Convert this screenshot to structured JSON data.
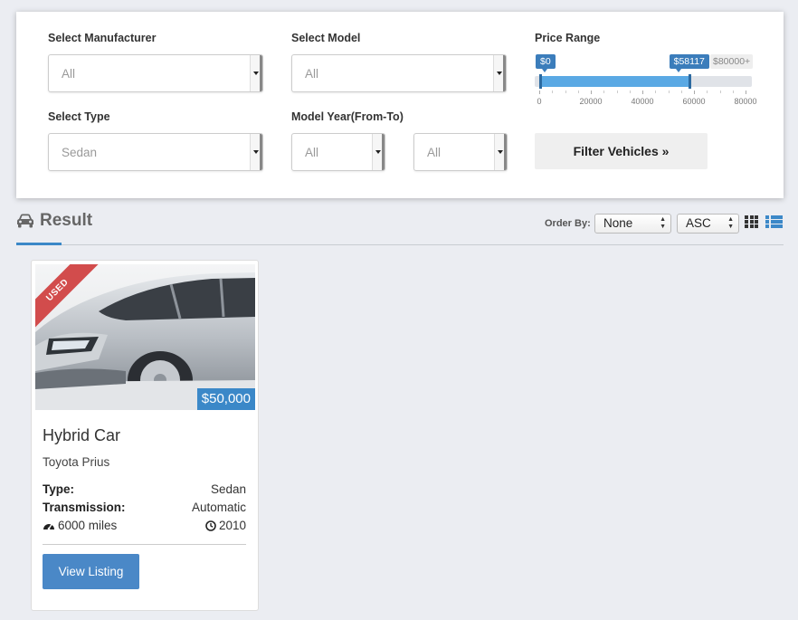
{
  "filters": {
    "manufacturer": {
      "label": "Select Manufacturer",
      "value": "All"
    },
    "model": {
      "label": "Select Model",
      "value": "All"
    },
    "type": {
      "label": "Select Type",
      "value": "Sedan"
    },
    "model_year": {
      "label": "Model Year(From-To)",
      "from": "All",
      "to": "All"
    },
    "price_range": {
      "label": "Price Range",
      "min_label": "$0",
      "current_label": "$58117",
      "max_label": "$80000+",
      "min": 0,
      "max": 80000,
      "current": 58117,
      "ticks": [
        "0",
        "20000",
        "40000",
        "60000",
        "80000"
      ]
    },
    "submit_label": "Filter Vehicles »"
  },
  "results": {
    "title": "Result",
    "order_by_label": "Order By:",
    "order_by_value": "None",
    "order_dir_value": "ASC"
  },
  "listings": [
    {
      "ribbon": "USED",
      "price": "$50,000",
      "title": "Hybrid Car",
      "subtitle": "Toyota Prius",
      "type_label": "Type:",
      "type_value": "Sedan",
      "transmission_label": "Transmission:",
      "transmission_value": "Automatic",
      "mileage": "6000 miles",
      "year": "2010",
      "button_label": "View Listing"
    }
  ],
  "colors": {
    "accent": "#3b88c8",
    "slider_fill": "#5aa9e4",
    "ribbon": "#d24c4c",
    "background": "#ebedf2"
  },
  "icons": {
    "result": "car-icon",
    "mileage": "speedometer-icon",
    "year": "clock-icon",
    "grid_view": "grid-view-icon",
    "list_view": "list-view-icon"
  }
}
